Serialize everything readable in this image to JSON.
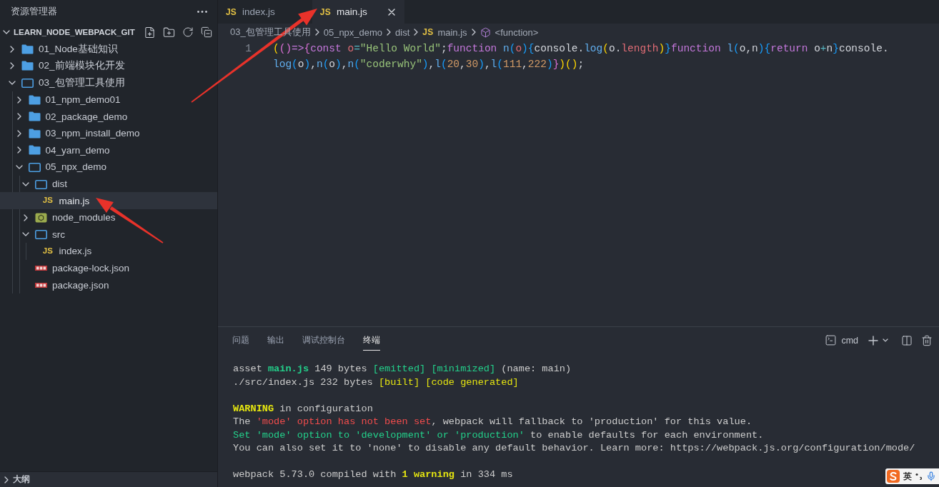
{
  "sidebar": {
    "title": "资源管理器",
    "section": {
      "title": "LEARN_NODE_WEBPACK_GIT",
      "expanded": true
    },
    "tree": [
      {
        "label": "01_Node基础知识",
        "kind": "folder",
        "expanded": false,
        "selected": false
      },
      {
        "label": "02_前端模块化开发",
        "kind": "folder",
        "expanded": false,
        "selected": false
      },
      {
        "label": "03_包管理工具使用",
        "kind": "folder",
        "expanded": true,
        "selected": false,
        "children": [
          {
            "label": "01_npm_demo01",
            "kind": "folder",
            "expanded": false,
            "selected": false
          },
          {
            "label": "02_package_demo",
            "kind": "folder",
            "expanded": false,
            "selected": false
          },
          {
            "label": "03_npm_install_demo",
            "kind": "folder",
            "expanded": false,
            "selected": false
          },
          {
            "label": "04_yarn_demo",
            "kind": "folder",
            "expanded": false,
            "selected": false
          },
          {
            "label": "05_npx_demo",
            "kind": "folder",
            "expanded": true,
            "selected": false,
            "children": [
              {
                "label": "dist",
                "kind": "folder",
                "expanded": true,
                "selected": false,
                "children": [
                  {
                    "label": "main.js",
                    "kind": "js",
                    "icon_label": "JS",
                    "selected": true
                  }
                ]
              },
              {
                "label": "node_modules",
                "kind": "node-folder",
                "expanded": false,
                "selected": false
              },
              {
                "label": "src",
                "kind": "folder",
                "expanded": true,
                "selected": false,
                "children": [
                  {
                    "label": "index.js",
                    "kind": "js",
                    "icon_label": "JS",
                    "selected": false
                  }
                ]
              },
              {
                "label": "package-lock.json",
                "kind": "npm",
                "selected": false
              },
              {
                "label": "package.json",
                "kind": "npm",
                "selected": false
              }
            ]
          }
        ]
      }
    ],
    "bottom_section": {
      "title": "大纲",
      "expanded": false
    }
  },
  "editor": {
    "tabs": [
      {
        "label": "index.js",
        "icon_label": "JS",
        "selected": false
      },
      {
        "label": "main.js",
        "icon_label": "JS",
        "selected": true
      }
    ],
    "breadcrumb": [
      {
        "label": "03_包管理工具使用",
        "kind": "folder"
      },
      {
        "label": "05_npx_demo",
        "kind": "folder"
      },
      {
        "label": "dist",
        "kind": "folder"
      },
      {
        "label": "main.js",
        "kind": "file",
        "icon_label": "JS"
      },
      {
        "label": "<function>",
        "kind": "symbol"
      }
    ],
    "lines": [
      {
        "number": "1",
        "rows": [
          {
            "segments": [
              {
                "text": "(",
                "kind": "b1"
              },
              {
                "text": "()",
                "kind": "b2"
              },
              {
                "text": "=>",
                "kind": "keyword"
              },
              {
                "text": "{",
                "kind": "b2"
              },
              {
                "text": "const ",
                "kind": "keyword"
              },
              {
                "text": "o",
                "kind": "variable"
              },
              {
                "text": "=",
                "kind": "operator"
              },
              {
                "text": "\"Hello World\"",
                "kind": "string"
              },
              {
                "text": ";",
                "kind": "plain"
              },
              {
                "text": "function ",
                "kind": "keyword"
              },
              {
                "text": "n",
                "kind": "func"
              },
              {
                "text": "(",
                "kind": "b3"
              },
              {
                "text": "o",
                "kind": "variable"
              },
              {
                "text": ")",
                "kind": "b3"
              },
              {
                "text": "{",
                "kind": "b3"
              },
              {
                "text": "console.",
                "kind": "plain"
              },
              {
                "text": "log",
                "kind": "func"
              },
              {
                "text": "(",
                "kind": "b1"
              },
              {
                "text": "o.",
                "kind": "plain"
              },
              {
                "text": "length",
                "kind": "variable"
              },
              {
                "text": ")",
                "kind": "b1"
              },
              {
                "text": "}",
                "kind": "b3"
              },
              {
                "text": "function ",
                "kind": "keyword"
              },
              {
                "text": "l",
                "kind": "func"
              },
              {
                "text": "(",
                "kind": "b3"
              },
              {
                "text": "o,n",
                "kind": "plain"
              },
              {
                "text": ")",
                "kind": "b3"
              },
              {
                "text": "{",
                "kind": "b3"
              },
              {
                "text": "return",
                "kind": "keyword"
              },
              {
                "text": " o",
                "kind": "plain"
              },
              {
                "text": "+",
                "kind": "operator"
              },
              {
                "text": "n",
                "kind": "plain"
              },
              {
                "text": "}",
                "kind": "b3"
              },
              {
                "text": "console.",
                "kind": "plain"
              }
            ]
          },
          {
            "segments": [
              {
                "text": "log",
                "kind": "func"
              },
              {
                "text": "(",
                "kind": "b3"
              },
              {
                "text": "o",
                "kind": "plain"
              },
              {
                "text": ")",
                "kind": "b3"
              },
              {
                "text": ",",
                "kind": "plain"
              },
              {
                "text": "n",
                "kind": "func"
              },
              {
                "text": "(",
                "kind": "b3"
              },
              {
                "text": "o",
                "kind": "plain"
              },
              {
                "text": ")",
                "kind": "b3"
              },
              {
                "text": ",",
                "kind": "plain"
              },
              {
                "text": "n",
                "kind": "func"
              },
              {
                "text": "(",
                "kind": "b3"
              },
              {
                "text": "\"coderwhy\"",
                "kind": "string"
              },
              {
                "text": ")",
                "kind": "b3"
              },
              {
                "text": ",",
                "kind": "plain"
              },
              {
                "text": "l",
                "kind": "func"
              },
              {
                "text": "(",
                "kind": "b3"
              },
              {
                "text": "20",
                "kind": "number"
              },
              {
                "text": ",",
                "kind": "plain"
              },
              {
                "text": "30",
                "kind": "number"
              },
              {
                "text": ")",
                "kind": "b3"
              },
              {
                "text": ",",
                "kind": "plain"
              },
              {
                "text": "l",
                "kind": "func"
              },
              {
                "text": "(",
                "kind": "b3"
              },
              {
                "text": "111",
                "kind": "number"
              },
              {
                "text": ",",
                "kind": "plain"
              },
              {
                "text": "222",
                "kind": "number"
              },
              {
                "text": ")",
                "kind": "b3"
              },
              {
                "text": "}",
                "kind": "b2"
              },
              {
                "text": ")",
                "kind": "b1"
              },
              {
                "text": "()",
                "kind": "b1"
              },
              {
                "text": ";",
                "kind": "plain"
              }
            ]
          }
        ]
      }
    ]
  },
  "panel": {
    "tabs": [
      {
        "label": "问题",
        "selected": false
      },
      {
        "label": "输出",
        "selected": false
      },
      {
        "label": "调试控制台",
        "selected": false
      },
      {
        "label": "终端",
        "selected": true
      }
    ],
    "shell": "cmd",
    "output": [
      {
        "lines": [
          {
            "segments": [
              {
                "text": "asset ",
                "kind": "plain"
              },
              {
                "text": "main.js",
                "kind": "green-bold"
              },
              {
                "text": " 149 bytes ",
                "kind": "plain"
              },
              {
                "text": "[emitted] ",
                "kind": "green"
              },
              {
                "text": "[minimized]",
                "kind": "green"
              },
              {
                "text": " (name: main)",
                "kind": "plain"
              }
            ]
          },
          {
            "segments": [
              {
                "text": "./src/index.js 232 bytes ",
                "kind": "plain"
              },
              {
                "text": "[built] ",
                "kind": "yellow"
              },
              {
                "text": "[code generated]",
                "kind": "yellow"
              }
            ]
          }
        ]
      },
      {
        "lines": [
          {
            "segments": [
              {
                "text": "WARNING",
                "kind": "yellow-bold"
              },
              {
                "text": " in configuration",
                "kind": "plain"
              }
            ]
          },
          {
            "segments": [
              {
                "text": "The ",
                "kind": "plain"
              },
              {
                "text": "'mode' option has not been set",
                "kind": "red"
              },
              {
                "text": ", webpack will fallback to 'production' for this value.",
                "kind": "plain"
              }
            ]
          },
          {
            "segments": [
              {
                "text": "Set 'mode' option to 'development' or 'production'",
                "kind": "green"
              },
              {
                "text": " to enable defaults for each environment.",
                "kind": "plain"
              }
            ]
          },
          {
            "segments": [
              {
                "text": "You can also set it to 'none' to disable any default behavior. Learn more: https://webpack.js.org/configuration/mode/",
                "kind": "plain"
              }
            ]
          }
        ]
      },
      {
        "lines": [
          {
            "segments": [
              {
                "text": "webpack 5.73.0 compiled with ",
                "kind": "plain"
              },
              {
                "text": "1 warning",
                "kind": "yellow-bold"
              },
              {
                "text": " in 334 ms",
                "kind": "plain"
              }
            ]
          }
        ]
      }
    ]
  },
  "ime": {
    "mode": "英"
  }
}
